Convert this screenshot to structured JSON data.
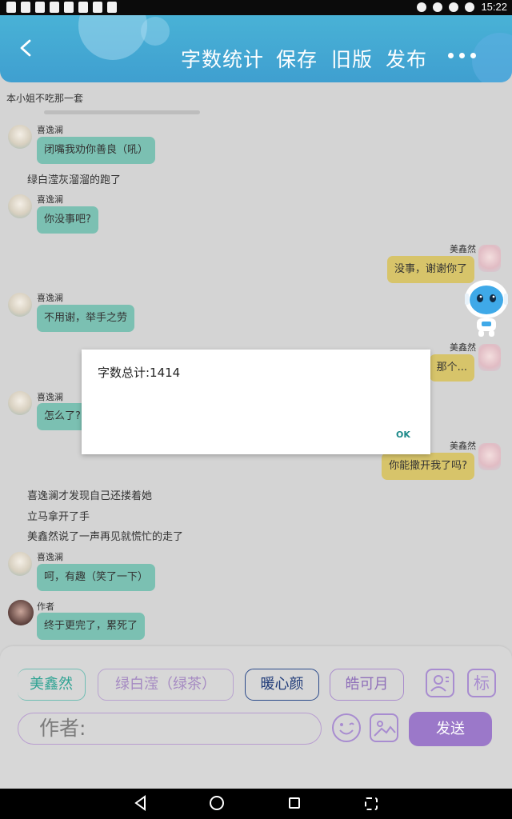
{
  "status": {
    "time": "15:22"
  },
  "header": {
    "back_icon": "chevron-left-icon",
    "word_count": "字数统计",
    "save": "保存",
    "old_version": "旧版",
    "publish": "发布",
    "more_icon": "more-dots-icon"
  },
  "chat": {
    "title": "本小姐不吃那一套",
    "items": [
      {
        "sender": "喜逸澜",
        "text": "闭嘴我劝你善良（吼）"
      },
      {
        "narration": "绿白滢灰溜溜的跑了"
      },
      {
        "sender": "喜逸澜",
        "text": "你没事吧?"
      },
      {
        "sender": "美鑫然",
        "text": "没事，谢谢你了"
      },
      {
        "sender": "喜逸澜",
        "text": "不用谢，举手之劳"
      },
      {
        "sender": "美鑫然",
        "text": "那个..."
      },
      {
        "sender": "喜逸澜",
        "text": "怎么了?"
      },
      {
        "sender": "美鑫然",
        "text": "你能撒开我了吗?"
      },
      {
        "narration": "喜逸澜才发现自己还搂着她"
      },
      {
        "narration": "立马拿开了手"
      },
      {
        "narration": "美鑫然说了一声再见就慌忙的走了"
      },
      {
        "sender": "喜逸澜",
        "text": "呵，有趣（笑了一下）"
      },
      {
        "sender": "作者",
        "text": "终于更完了，累死了"
      }
    ]
  },
  "dialog": {
    "message": "字数总计:1414",
    "ok": "OK"
  },
  "composer": {
    "roles": [
      "美鑫然",
      "绿白滢（绿茶）",
      "暖心颜",
      "皓可月"
    ],
    "mark_button": "标",
    "input_placeholder": "作者:",
    "send": "发送"
  }
}
